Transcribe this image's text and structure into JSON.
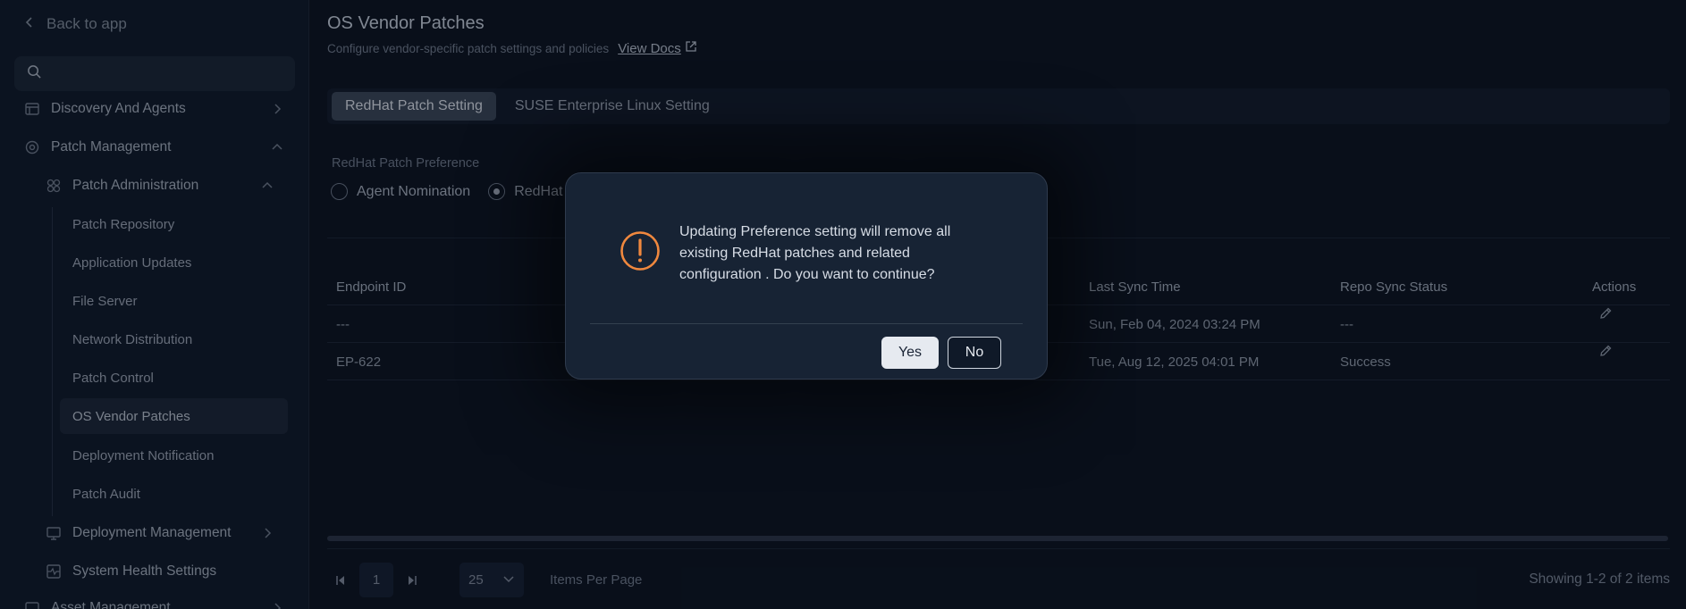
{
  "sidebar": {
    "back_label": "Back to app",
    "search": {
      "value": "",
      "placeholder": ""
    },
    "items": [
      {
        "label": "Discovery And Agents",
        "icon": "server-icon"
      },
      {
        "label": "Patch Management",
        "icon": "gear-icon"
      },
      {
        "label": "Patch Administration",
        "icon": "grid-icon"
      },
      {
        "label": "Deployment Management",
        "icon": "monitor-icon"
      },
      {
        "label": "System Health Settings",
        "icon": "health-icon"
      },
      {
        "label": "Asset Management",
        "icon": "box-icon"
      }
    ],
    "sub_items": [
      "Patch Repository",
      "Application Updates",
      "File Server",
      "Network Distribution",
      "Patch Control",
      "OS Vendor Patches",
      "Deployment Notification",
      "Patch Audit"
    ],
    "active_sub_item": "OS Vendor Patches"
  },
  "header": {
    "title": "OS Vendor Patches",
    "subtitle": "Configure vendor-specific patch settings and policies",
    "docs_link": "View Docs"
  },
  "tabs": [
    {
      "label": "RedHat Patch Setting",
      "active": true
    },
    {
      "label": "SUSE Enterprise Linux Setting",
      "active": false
    }
  ],
  "preference": {
    "label": "RedHat Patch Preference",
    "options": [
      {
        "label": "Agent Nomination",
        "selected": false
      },
      {
        "label": "RedHat",
        "selected": true
      }
    ]
  },
  "table": {
    "columns": [
      "Endpoint ID",
      "Last Sync Time",
      "Repo Sync Status",
      "Actions"
    ],
    "rows": [
      {
        "endpoint_id": "---",
        "last_sync": "Sun, Feb 04, 2024 03:24 PM",
        "status": "---"
      },
      {
        "endpoint_id": "EP-622",
        "last_sync": "Tue, Aug 12, 2025 04:01 PM",
        "status": "Success"
      }
    ]
  },
  "pagination": {
    "page": "1",
    "page_size": "25",
    "items_per_page_label": "Items Per Page",
    "showing": "Showing 1-2 of 2 items"
  },
  "dialog": {
    "message": "Updating Preference setting will remove all existing RedHat patches and related configuration . Do you want to continue?",
    "yes_label": "Yes",
    "no_label": "No",
    "icon": "warning-icon",
    "accent_color": "#f0883e"
  }
}
